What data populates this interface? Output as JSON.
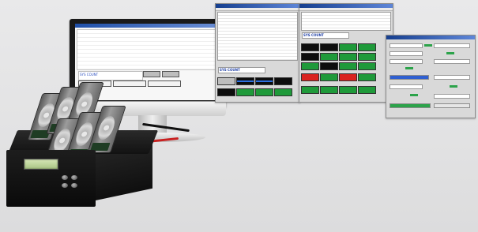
{
  "monitor": {
    "status_text": "SYS COUNT",
    "window_title": ""
  },
  "center_window": {
    "status_text": "SYS COUNT"
  },
  "right_window": {
    "status_text": "SYS COUNT"
  },
  "colors": {
    "background": "#e5e5e6",
    "title_bar": "#1f4fa8",
    "slot_green": "#1f9a3a",
    "slot_red": "#d9231f",
    "slot_black": "#0d0d0d",
    "device_body": "#121212",
    "lcd": "#c2da9c"
  },
  "icons": [
    "duplicator-device",
    "hard-drive",
    "monitor"
  ]
}
